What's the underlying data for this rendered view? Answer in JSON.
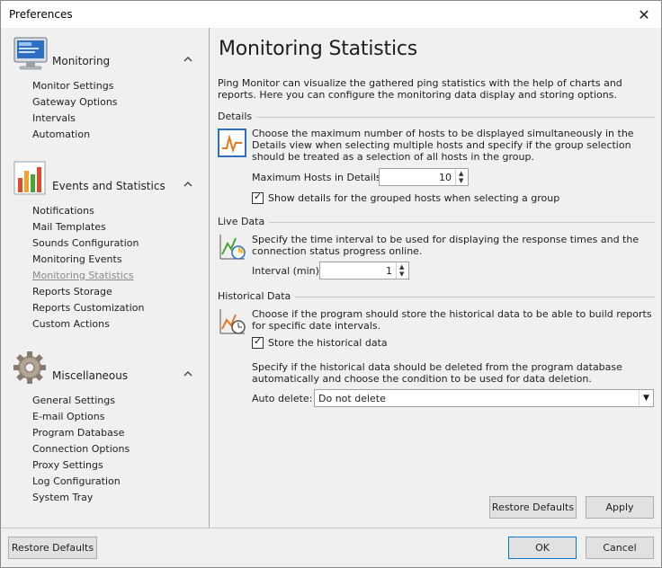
{
  "window": {
    "title": "Preferences"
  },
  "sidebar": {
    "groups": [
      {
        "title": "Monitoring",
        "items": [
          "Monitor Settings",
          "Gateway Options",
          "Intervals",
          "Automation"
        ]
      },
      {
        "title": "Events and Statistics",
        "items": [
          "Notifications",
          "Mail Templates",
          "Sounds Configuration",
          "Monitoring Events",
          "Monitoring Statistics",
          "Reports Storage",
          "Reports Customization",
          "Custom Actions"
        ]
      },
      {
        "title": "Miscellaneous",
        "items": [
          "General Settings",
          "E-mail Options",
          "Program Database",
          "Connection Options",
          "Proxy Settings",
          "Log Configuration",
          "System Tray"
        ]
      }
    ],
    "active_item": "Monitoring Statistics"
  },
  "main": {
    "title": "Monitoring Statistics",
    "intro": "Ping Monitor can visualize the gathered ping statistics with the help of charts and reports. Here you can configure the monitoring data display and storing options.",
    "details": {
      "heading": "Details",
      "text": "Choose the maximum number of hosts to be displayed simultaneously in the Details view when selecting multiple hosts and specify if the group selection should be treated as a selection of all hosts in the group.",
      "max_hosts_label": "Maximum Hosts in Details:",
      "max_hosts_value": "10",
      "grouped_label": "Show details for the grouped hosts when selecting a group",
      "grouped_checked": true
    },
    "live": {
      "heading": "Live Data",
      "text": "Specify the time interval to be used for displaying the response times and the connection status progress online.",
      "interval_label": "Interval (min):",
      "interval_value": "1"
    },
    "historical": {
      "heading": "Historical Data",
      "text": "Choose if the program should store the historical data to be able to build reports for specific date intervals.",
      "store_label": "Store the historical data",
      "store_checked": true,
      "delete_text": "Specify if the historical data should be deleted from the program database automatically and choose the condition to be used for data deletion.",
      "auto_delete_label": "Auto delete:",
      "auto_delete_value": "Do not delete"
    },
    "restore_defaults": "Restore Defaults",
    "apply": "Apply"
  },
  "footer": {
    "restore_defaults": "Restore Defaults",
    "ok": "OK",
    "cancel": "Cancel"
  },
  "colors": {
    "accent": "#0078d7",
    "chart_orange": "#e87722",
    "sidebar_bg": "#f0f0f0"
  },
  "icons": {
    "group_icons": [
      "monitor-icon",
      "bar-chart-icon",
      "gear-icon"
    ],
    "section_icons": [
      "details-chart-icon",
      "live-chart-icon",
      "historical-chart-icon"
    ]
  }
}
